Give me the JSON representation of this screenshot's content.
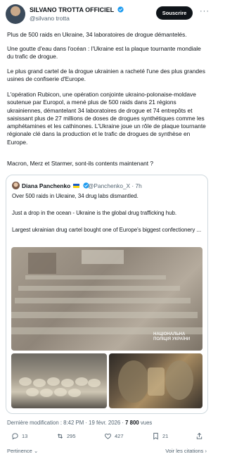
{
  "author": {
    "name": "SILVANO TROTTA OFFICIEL",
    "handle": "@silvano trotta",
    "verified_icon": "verified-badge-icon",
    "subscribe_label": "Souscrire",
    "more_label": "···"
  },
  "post": {
    "paragraphs": [
      "Plus de 500 raids en Ukraine, 34 laboratoires de drogue démantelés.",
      "Une goutte d'eau dans l'océan : l'Ukraine est la plaque tournante mondiale du trafic de drogue.",
      "Le plus grand cartel de la drogue ukrainien a racheté l'une des plus grandes usines de confiserie d'Europe.",
      "L'opération Rubicon, une opération conjointe ukraino-polonaise-moldave soutenue par Europol, a mené plus de 500 raids dans 21 régions ukrainiennes, démantelant 34 laboratoires de drogue et 74 entrepôts et saisissant plus de 27 millions de doses de drogues synthétiques comme les amphétamines et les cathinones. L'Ukraine joue un rôle de plaque tournante régionale clé dans la production et le trafic de drogues de synthèse en Europe.",
      "Macron, Merz et Starmer, sont-ils contents maintenant ?"
    ]
  },
  "quote": {
    "name": "Diana Panchenko",
    "handle_time": "@Panchenko_X · 7h",
    "lines": [
      "Over 500 raids in Ukraine, 34 drug labs dismantled.",
      "Just a drop in the ocean - Ukraine is the global drug trafficking hub.",
      "Largest ukrainian drug cartel bought one of Europe's biggest confectionery ..."
    ],
    "watermark": "НАЦІОНАЛЬНА ПОЛІЦІЯ УКРАЇНИ"
  },
  "meta": {
    "prefix": "Dernière modification : 8:42 PM · 19 févr. 2026 · ",
    "views_count": "7 800",
    "views_label": " vues"
  },
  "actions": {
    "replies": "13",
    "reposts": "295",
    "likes": "427",
    "bookmarks": "21"
  },
  "footer": {
    "relevance": "Pertinence ⌄",
    "quotes": "Voir les citations ›"
  }
}
